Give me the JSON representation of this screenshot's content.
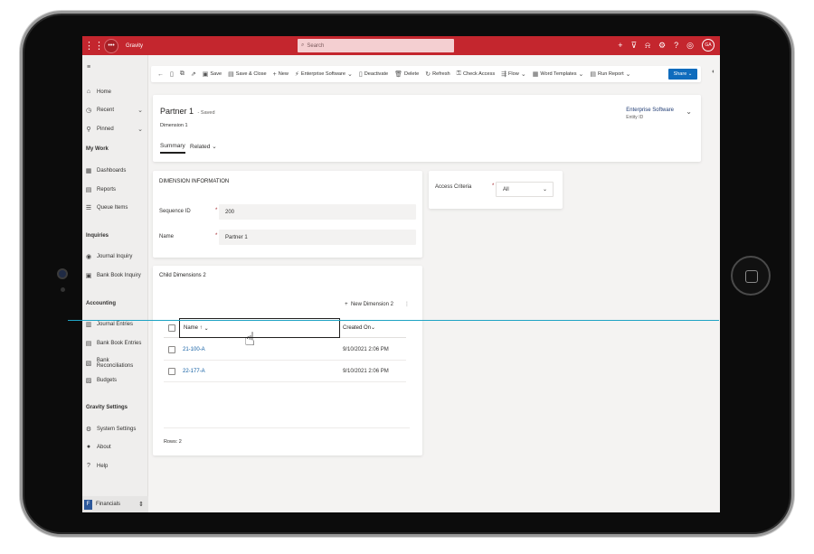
{
  "topbar": {
    "app_name": "Gravity",
    "search_placeholder": "Search",
    "avatar_initials": "GA"
  },
  "nav": {
    "items": [
      {
        "label": "Home"
      },
      {
        "label": "Recent"
      },
      {
        "label": "Pinned"
      }
    ],
    "my_work": {
      "heading": "My Work",
      "items": [
        {
          "label": "Dashboards"
        },
        {
          "label": "Reports"
        },
        {
          "label": "Queue Items"
        }
      ]
    },
    "inquiries": {
      "heading": "Inquiries",
      "items": [
        {
          "label": "Journal Inquiry"
        },
        {
          "label": "Bank Book Inquiry"
        }
      ]
    },
    "accounting": {
      "heading": "Accounting",
      "items": [
        {
          "label": "Journal Entries"
        },
        {
          "label": "Bank Book Entries"
        },
        {
          "label": "Bank Reconciliations"
        },
        {
          "label": "Budgets"
        }
      ]
    },
    "gravity_settings": {
      "heading": "Gravity Settings",
      "items": [
        {
          "label": "System Settings"
        },
        {
          "label": "About"
        },
        {
          "label": "Help"
        }
      ]
    },
    "area": {
      "badge": "F",
      "label": "Financials"
    }
  },
  "commands": {
    "save": "Save",
    "save_close": "Save & Close",
    "new": "New",
    "enterprise_software": "Enterprise Software",
    "deactivate": "Deactivate",
    "delete": "Delete",
    "refresh": "Refresh",
    "check_access": "Check Access",
    "flow": "Flow",
    "word_templates": "Word Templates",
    "run_report": "Run Report",
    "share": "Share"
  },
  "record": {
    "title": "Partner 1",
    "saved_status": "- Saved",
    "entity": "Dimension 1",
    "tabs": {
      "summary": "Summary",
      "related": "Related"
    },
    "header_field": {
      "value": "Enterprise Software",
      "label": "Entity ID"
    }
  },
  "dimension_info": {
    "title": "DIMENSION INFORMATION",
    "sequence_label": "Sequence ID",
    "sequence_value": "200",
    "name_label": "Name",
    "name_value": "Partner 1",
    "required_mark": "*"
  },
  "access": {
    "label": "Access Criteria",
    "value": "All"
  },
  "child_dimensions": {
    "title": "Child Dimensions 2",
    "new_button": "New Dimension 2",
    "columns": {
      "name": "Name ↑",
      "created_on": "Created On"
    },
    "rows": [
      {
        "name": "21-100-A",
        "created_on": "9/10/2021 2:06 PM"
      },
      {
        "name": "22-177-A",
        "created_on": "9/10/2021 2:06 PM"
      }
    ],
    "rows_count": "Rows: 2"
  },
  "colors": {
    "brand_red": "#c4262e",
    "share_blue": "#0f6cbd",
    "link_blue": "#115ea3",
    "overlay_line": "#1fa3c4"
  }
}
